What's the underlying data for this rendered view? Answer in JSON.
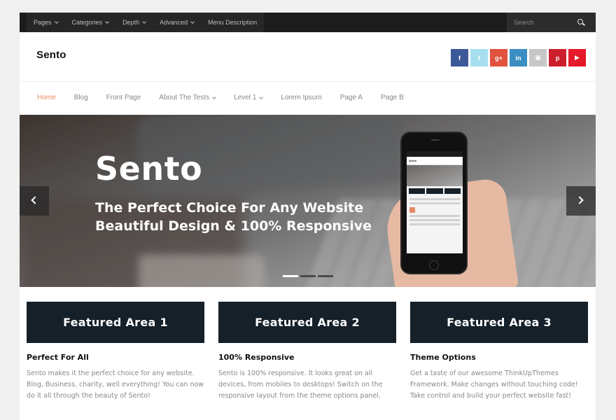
{
  "topbar": {
    "menu": [
      {
        "label": "Pages",
        "dropdown": true
      },
      {
        "label": "Categories",
        "dropdown": true
      },
      {
        "label": "Depth",
        "dropdown": true
      },
      {
        "label": "Advanced",
        "dropdown": true
      },
      {
        "label": "Menu Description",
        "dropdown": false
      }
    ],
    "search_placeholder": "Search"
  },
  "header": {
    "logo": "Sento",
    "social": [
      {
        "name": "facebook-icon",
        "glyph": "f",
        "color": "#3b5998"
      },
      {
        "name": "twitter-icon",
        "glyph": "t",
        "color": "#a7dff0"
      },
      {
        "name": "google-plus-icon",
        "glyph": "g+",
        "color": "#e0533d"
      },
      {
        "name": "linkedin-icon",
        "glyph": "in",
        "color": "#3b8ec2"
      },
      {
        "name": "flickr-icon",
        "glyph": "▣",
        "color": "#c7c7c7"
      },
      {
        "name": "pinterest-icon",
        "glyph": "p",
        "color": "#cc1f2d"
      },
      {
        "name": "youtube-icon",
        "glyph": "▶",
        "color": "#e4192a"
      }
    ]
  },
  "nav": [
    {
      "label": "Home",
      "active": true,
      "dropdown": false
    },
    {
      "label": "Blog",
      "active": false,
      "dropdown": false
    },
    {
      "label": "Front Page",
      "active": false,
      "dropdown": false
    },
    {
      "label": "About The Tests",
      "active": false,
      "dropdown": true
    },
    {
      "label": "Level 1",
      "active": false,
      "dropdown": true
    },
    {
      "label": "Lorem Ipsum",
      "active": false,
      "dropdown": false
    },
    {
      "label": "Page A",
      "active": false,
      "dropdown": false
    },
    {
      "label": "Page B",
      "active": false,
      "dropdown": false
    }
  ],
  "slider": {
    "title": "Sento",
    "subtitle_line1": "The Perfect Choice For Any Website",
    "subtitle_line2": "Beautiful Design & 100% Responsive",
    "dots": [
      true,
      false,
      false
    ]
  },
  "featured": [
    {
      "box_label": "Featured Area 1",
      "heading": "Perfect For All",
      "text": "Sento makes it the perfect choice for any website. Blog, Business, charity, well everything! You can now do it all through the beauty of Sento!"
    },
    {
      "box_label": "Featured Area 2",
      "heading": "100% Responsive",
      "text": "Sento is 100% responsive. It looks great on all devices, from mobiles to desktops! Switch on the responsive layout from the theme options panel."
    },
    {
      "box_label": "Featured Area 3",
      "heading": "Theme Options",
      "text": "Get a taste of our awesome ThinkUpThemes Framework. Make changes without touching code! Take control and build your perfect website fast!"
    }
  ],
  "colors": {
    "accent": "#e58a67",
    "featured_box": "#152029",
    "topbar": "#1c1c1c"
  }
}
